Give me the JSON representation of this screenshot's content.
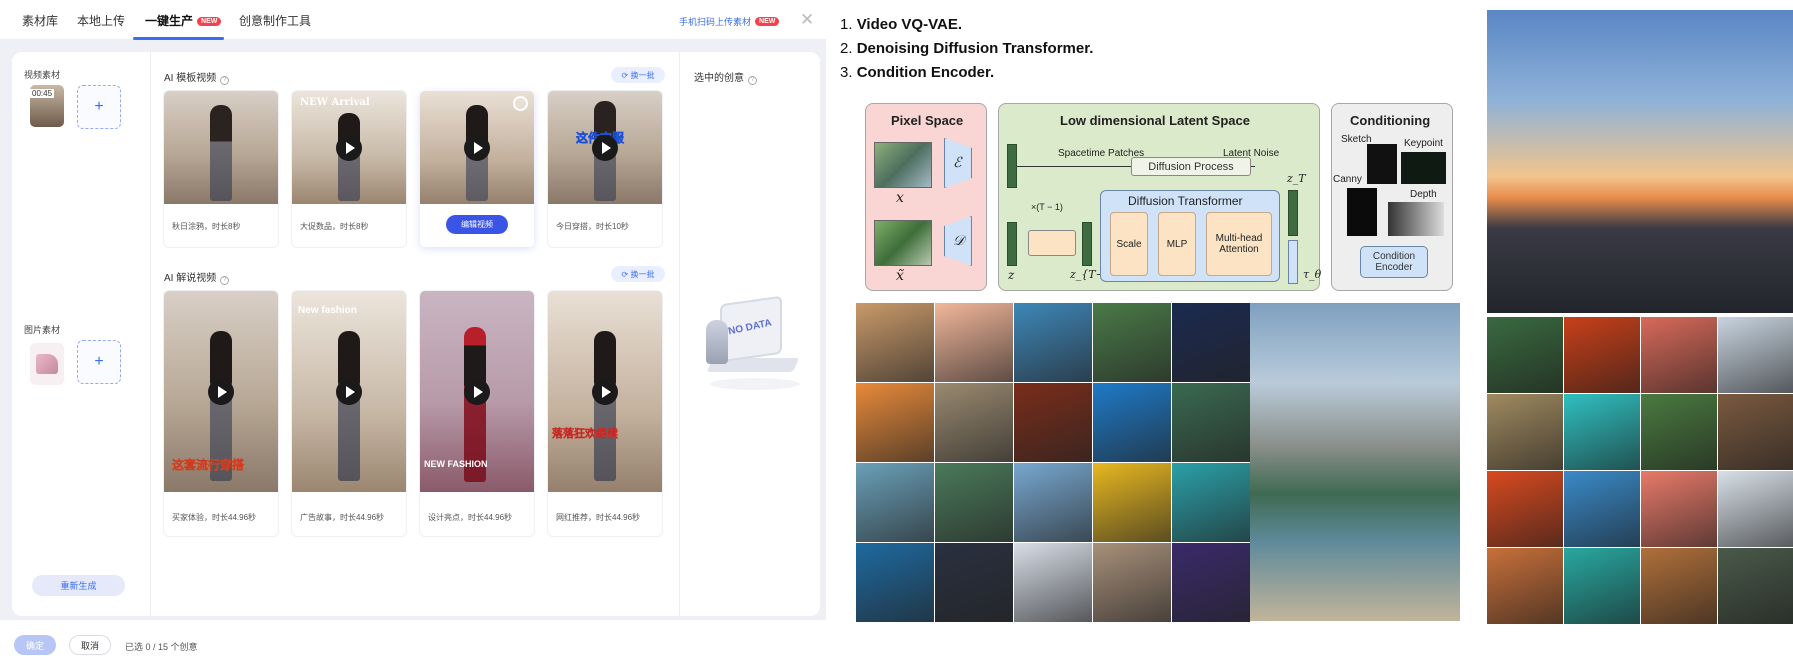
{
  "app": {
    "tabs": [
      {
        "label": "素材库"
      },
      {
        "label": "本地上传"
      },
      {
        "label": "一键生产",
        "badge": "NEW"
      },
      {
        "label": "创意制作工具"
      }
    ],
    "scan_link": "手机扫码上传素材",
    "scan_badge": "NEW",
    "close_icon": "close-icon",
    "sidebar": {
      "video_label": "视频素材",
      "video_duration": "00:45",
      "image_label": "图片素材",
      "add_symbol": "+",
      "regenerate": "重新生成"
    },
    "section_template": {
      "title": "AI 模板视频",
      "swap": "换一批"
    },
    "section_narration": {
      "title": "AI 解说视频",
      "swap": "换一批"
    },
    "template_cards": [
      {
        "caption": "秋日涂鸦，时长8秒",
        "overlay": ""
      },
      {
        "caption": "大促数品，时长8秒",
        "overlay": "NEW Arrival"
      },
      {
        "caption": "",
        "overlay": "",
        "edit": "编辑视频"
      },
      {
        "caption": "今日穿搭，时长10秒",
        "overlay": "这件衣服"
      }
    ],
    "narration_cards": [
      {
        "caption": "买家体验，时长44.96秒",
        "overlay": "这套流行穿搭"
      },
      {
        "caption": "广告故事，时长44.96秒",
        "overlay": "New fashion"
      },
      {
        "caption": "设计亮点，时长44.96秒",
        "overlay": "NEW FASHION"
      },
      {
        "caption": "网红推荐，时长44.96秒",
        "overlay": "落落狂欢继续"
      }
    ],
    "selected_panel": {
      "title": "选中的创意",
      "empty": "NO DATA"
    },
    "footer": {
      "confirm": "确定",
      "cancel": "取消",
      "count": "已选 0 / 15 个创意"
    },
    "colors": {
      "accent": "#3a6df0",
      "badge": "#f5414b",
      "panel_bg": "#eef0f6"
    }
  },
  "slide": {
    "steps": [
      {
        "num": "1.",
        "text": "Video VQ-VAE."
      },
      {
        "num": "2.",
        "text": "Denoising Diffusion Transformer."
      },
      {
        "num": "3.",
        "text": "Condition Encoder."
      }
    ],
    "diagram": {
      "pixel_space": "Pixel Space",
      "latent_space": "Low dimensional Latent Space",
      "conditioning": "Conditioning",
      "spacetime": "Spacetime Patches",
      "latent_noise": "Latent Noise",
      "diffusion_process": "Diffusion Process",
      "diffusion_transformer": "Diffusion Transformer",
      "scale": "Scale",
      "mlp": "MLP",
      "attention": "Multi-head Attention",
      "times": "×(T − 1)",
      "sketch": "Sketch",
      "keypoint": "Keypoint",
      "canny": "Canny",
      "depth": "Depth",
      "cond_encoder": "Condition Encoder",
      "sym_x": "x",
      "sym_xhat": "x̃",
      "sym_E": "ℰ",
      "sym_D": "𝒟",
      "sym_z": "z",
      "sym_zT": "z_T",
      "sym_zT1": "z_{T−1}",
      "sym_tau": "τ_θ",
      "colors": {
        "pixel": "#f9d5d3",
        "latent": "#dbeacb",
        "cond": "#eeeeee",
        "inner": "#fbe3c4",
        "dt": "#cfe2f7"
      }
    }
  }
}
